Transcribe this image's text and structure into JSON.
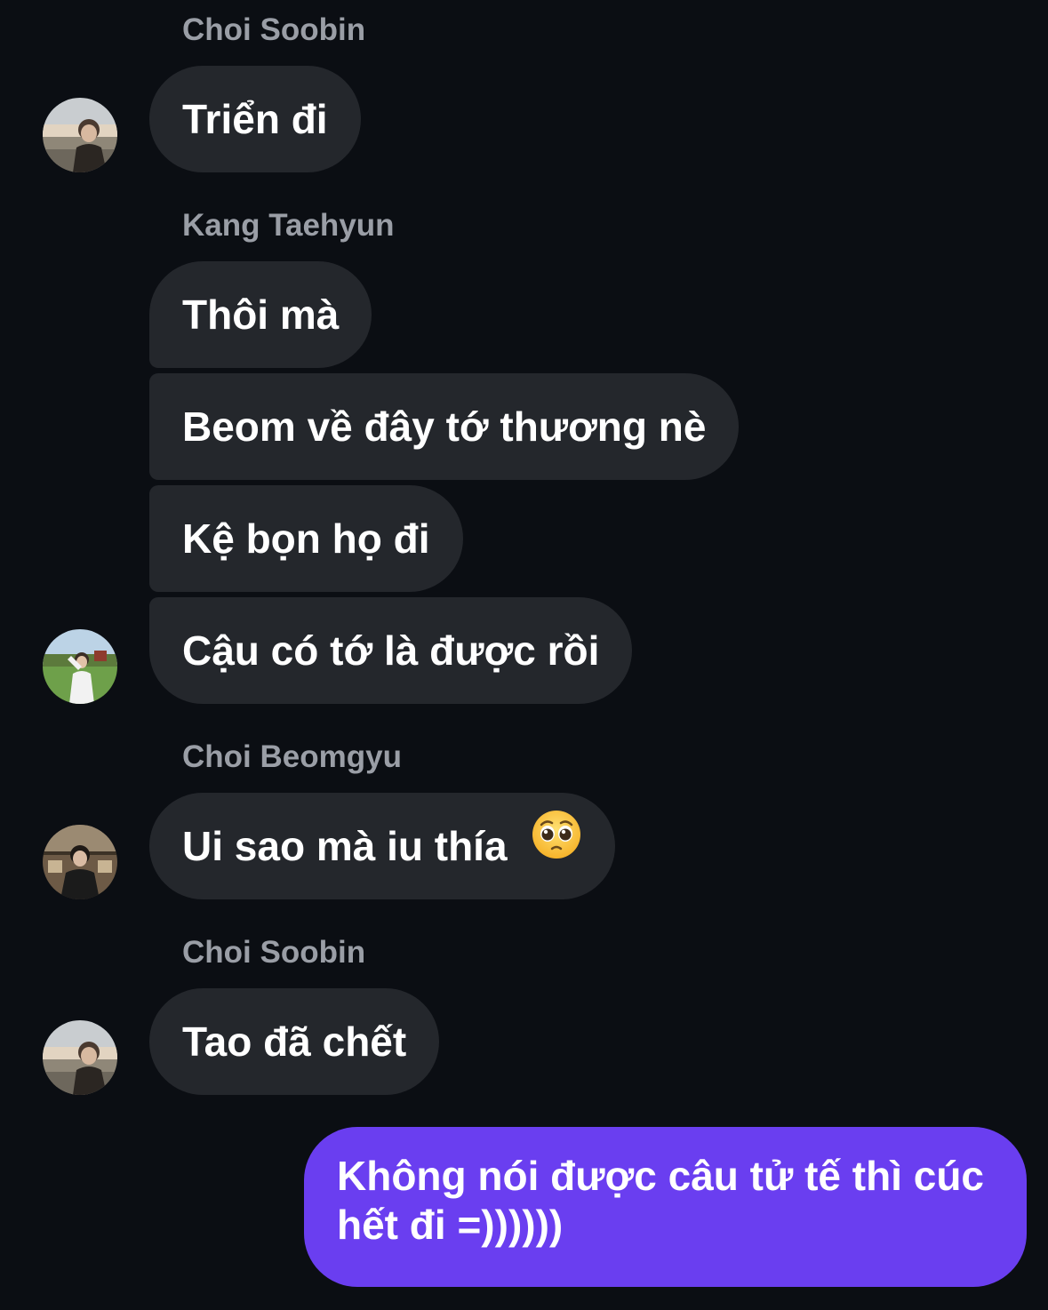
{
  "messages": {
    "group1": {
      "sender": "Choi Soobin",
      "text": "Triển đi",
      "avatar_icon": "avatar-choi-soobin"
    },
    "group2": {
      "sender": "Kang Taehyun",
      "texts": [
        "Thôi mà",
        "Beom về đây tớ thương nè",
        "Kệ bọn họ đi",
        "Cậu có tớ là được rồi"
      ],
      "avatar_icon": "avatar-kang-taehyun"
    },
    "group3": {
      "sender": "Choi Beomgyu",
      "text": "Ui sao mà iu thía",
      "emoji": "pleading-face-emoji",
      "avatar_icon": "avatar-choi-beomgyu"
    },
    "group4": {
      "sender": "Choi Soobin",
      "text": "Tao đã chết",
      "avatar_icon": "avatar-choi-soobin"
    },
    "outgoing": {
      "text": "Không nói được câu tử tế thì cúc hết đi =))))))"
    }
  },
  "colors": {
    "background": "#0b0e13",
    "incoming_bubble": "#24272c",
    "outgoing_bubble": "#6a3ef0",
    "sender_name": "#9a9ea6",
    "text": "#ffffff"
  }
}
